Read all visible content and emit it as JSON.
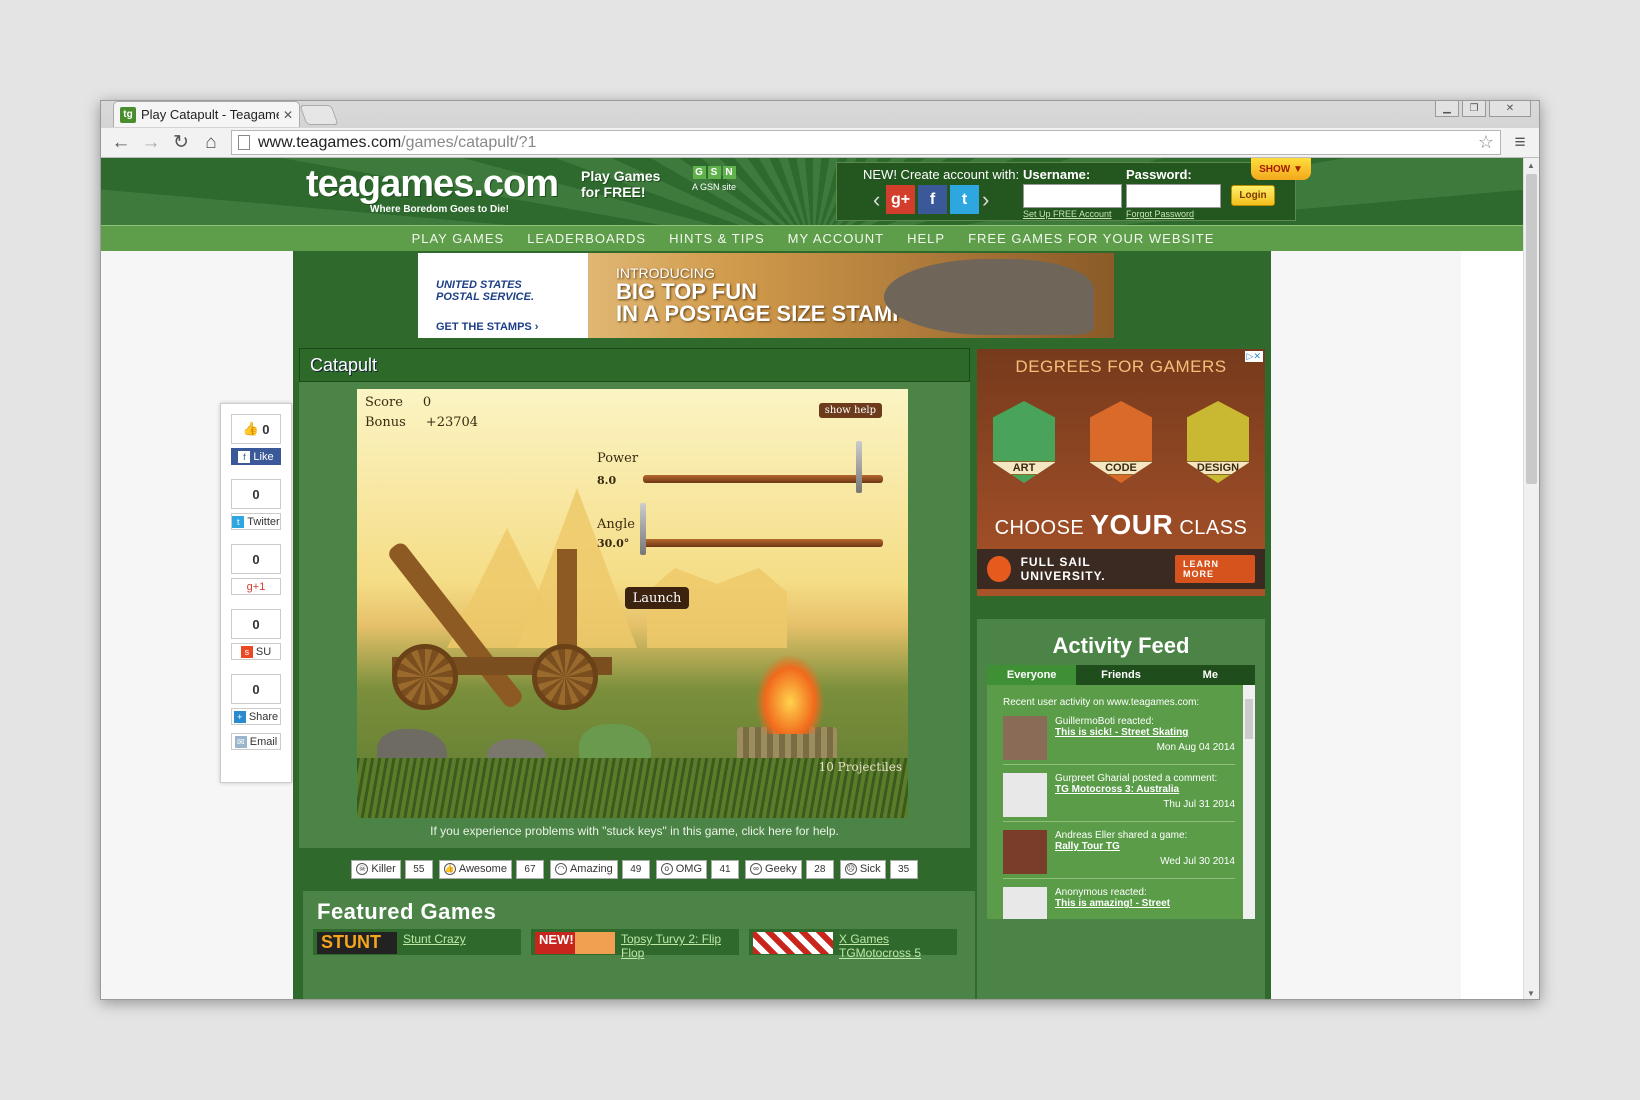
{
  "browser": {
    "tab_title": "Play Catapult - Teagames",
    "tab_favicon": "tg",
    "url_main": "www.teagames.com",
    "url_rest": "/games/catapult/?1"
  },
  "header": {
    "logo": "teagames.com",
    "tagline": "Where Boredom Goes to Die!",
    "promo": "Play Games for FREE!",
    "gsn_letters": [
      "G",
      "S",
      "N"
    ],
    "gsn_label": "A GSN site",
    "new_account": "NEW! Create account with:",
    "username_label": "Username:",
    "password_label": "Password:",
    "login_button": "Login",
    "setup_link": "Set Up FREE Account",
    "forgot_link": "Forgot Password",
    "show_label": "SHOW"
  },
  "nav": [
    "PLAY GAMES",
    "LEADERBOARDS",
    "HINTS & TIPS",
    "MY ACCOUNT",
    "HELP",
    "FREE GAMES FOR YOUR WEBSITE"
  ],
  "ad_top": {
    "brand1": "UNITED STATES",
    "brand2": "POSTAL SERVICE.",
    "cta": "GET THE STAMPS ›",
    "intro": "INTRODUCING",
    "line1": "BIG TOP FUN",
    "line2": "IN A POSTAGE SIZE STAMP"
  },
  "share": {
    "likes": "0",
    "fb_like": "Like",
    "twitter_count": "0",
    "twitter": "Twitter",
    "gplus_count": "0",
    "gplus": "g+1",
    "su_count": "0",
    "su": "SU",
    "share_count": "0",
    "share": "Share",
    "email": "Email"
  },
  "game": {
    "title": "Catapult",
    "score_label": "Score",
    "score": "0",
    "bonus_label": "Bonus",
    "bonus": "+23704",
    "show_help": "show help",
    "power_label": "Power",
    "power": "8.0",
    "power_level": 0.9,
    "angle_label": "Angle",
    "angle": "30.0°",
    "angle_level": 0.0,
    "launch": "Launch",
    "projectiles": "10 Projectiles",
    "stuck_text": "If you experience problems with \"stuck keys\" in this game, click here for help."
  },
  "ratings": [
    {
      "label": "Killer",
      "count": "55"
    },
    {
      "label": "Awesome",
      "count": "67"
    },
    {
      "label": "Amazing",
      "count": "49"
    },
    {
      "label": "OMG",
      "count": "41"
    },
    {
      "label": "Geeky",
      "count": "28"
    },
    {
      "label": "Sick",
      "count": "35"
    }
  ],
  "featured": {
    "title": "Featured Games",
    "games": [
      {
        "name": "Stunt Crazy",
        "thumb": "STUNT"
      },
      {
        "name": "Topsy Turvy 2: Flip Flop",
        "thumb": "NEW!"
      },
      {
        "name": "X Games TGMotocross 5",
        "thumb": ""
      }
    ]
  },
  "ad_right": {
    "title": "DEGREES FOR GAMERS",
    "shields": [
      "ART",
      "CODE",
      "DESIGN"
    ],
    "choose1": "CHOOSE",
    "choose2": "YOUR",
    "choose3": "CLASS",
    "school": "FULL SAIL UNIVERSITY.",
    "cta": "LEARN MORE"
  },
  "activity": {
    "title": "Activity Feed",
    "tabs": [
      "Everyone",
      "Friends",
      "Me"
    ],
    "recent": "Recent user activity on www.teagames.com:",
    "items": [
      {
        "text": "GuillermoBoti reacted:",
        "link": "This is sick! - Street Skating",
        "date": "Mon Aug 04 2014"
      },
      {
        "text": "Gurpreet Gharial posted a comment:",
        "link": "TG Motocross 3: Australia",
        "date": "Thu Jul 31 2014"
      },
      {
        "text": "Andreas Eller shared a game:",
        "link": "Rally Tour TG",
        "date": "Wed Jul 30 2014"
      },
      {
        "text": "Anonymous reacted:",
        "link": "This is amazing! - Street",
        "date": ""
      }
    ]
  }
}
